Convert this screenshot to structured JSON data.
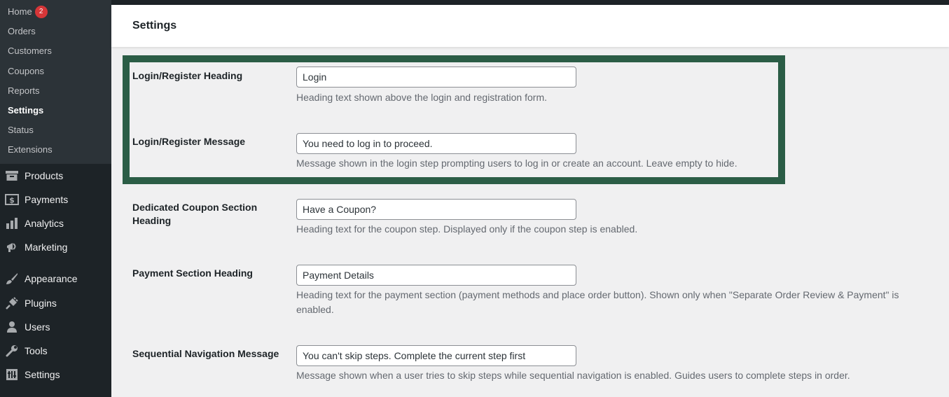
{
  "submenu": [
    {
      "label": "Home",
      "badge": "2"
    },
    {
      "label": "Orders"
    },
    {
      "label": "Customers"
    },
    {
      "label": "Coupons"
    },
    {
      "label": "Reports"
    },
    {
      "label": "Settings",
      "current": true
    },
    {
      "label": "Status"
    },
    {
      "label": "Extensions"
    }
  ],
  "menu": [
    {
      "label": "Products",
      "icon": "products-icon"
    },
    {
      "label": "Payments",
      "icon": "payments-icon"
    },
    {
      "label": "Analytics",
      "icon": "analytics-icon"
    },
    {
      "label": "Marketing",
      "icon": "marketing-icon"
    },
    {
      "label": "Appearance",
      "icon": "appearance-icon"
    },
    {
      "label": "Plugins",
      "icon": "plugins-icon"
    },
    {
      "label": "Users",
      "icon": "users-icon"
    },
    {
      "label": "Tools",
      "icon": "tools-icon"
    },
    {
      "label": "Settings",
      "icon": "settings-icon"
    }
  ],
  "header": {
    "title": "Settings"
  },
  "fields": [
    {
      "label": "Login/Register Heading",
      "value": "Login",
      "description": "Heading text shown above the login and registration form."
    },
    {
      "label": "Login/Register Message",
      "value": "You need to log in to proceed.",
      "description": "Message shown in the login step prompting users to log in or create an account. Leave empty to hide."
    },
    {
      "label": "Dedicated Coupon Section Heading",
      "value": "Have a Coupon?",
      "description": "Heading text for the coupon step. Displayed only if the coupon step is enabled."
    },
    {
      "label": "Payment Section Heading",
      "value": "Payment Details",
      "description": "Heading text for the payment section (payment methods and place order button). Shown only when \"Separate Order Review & Payment\" is enabled."
    },
    {
      "label": "Sequential Navigation Message",
      "value": "You can't skip steps. Complete the current step first",
      "description": "Message shown when a user tries to skip steps while sequential navigation is enabled. Guides users to complete steps in order."
    }
  ],
  "colors": {
    "sidebar": "#1d2327",
    "submenu": "#2c3338",
    "highlight": "#2b5d46",
    "badge": "#d63638"
  }
}
